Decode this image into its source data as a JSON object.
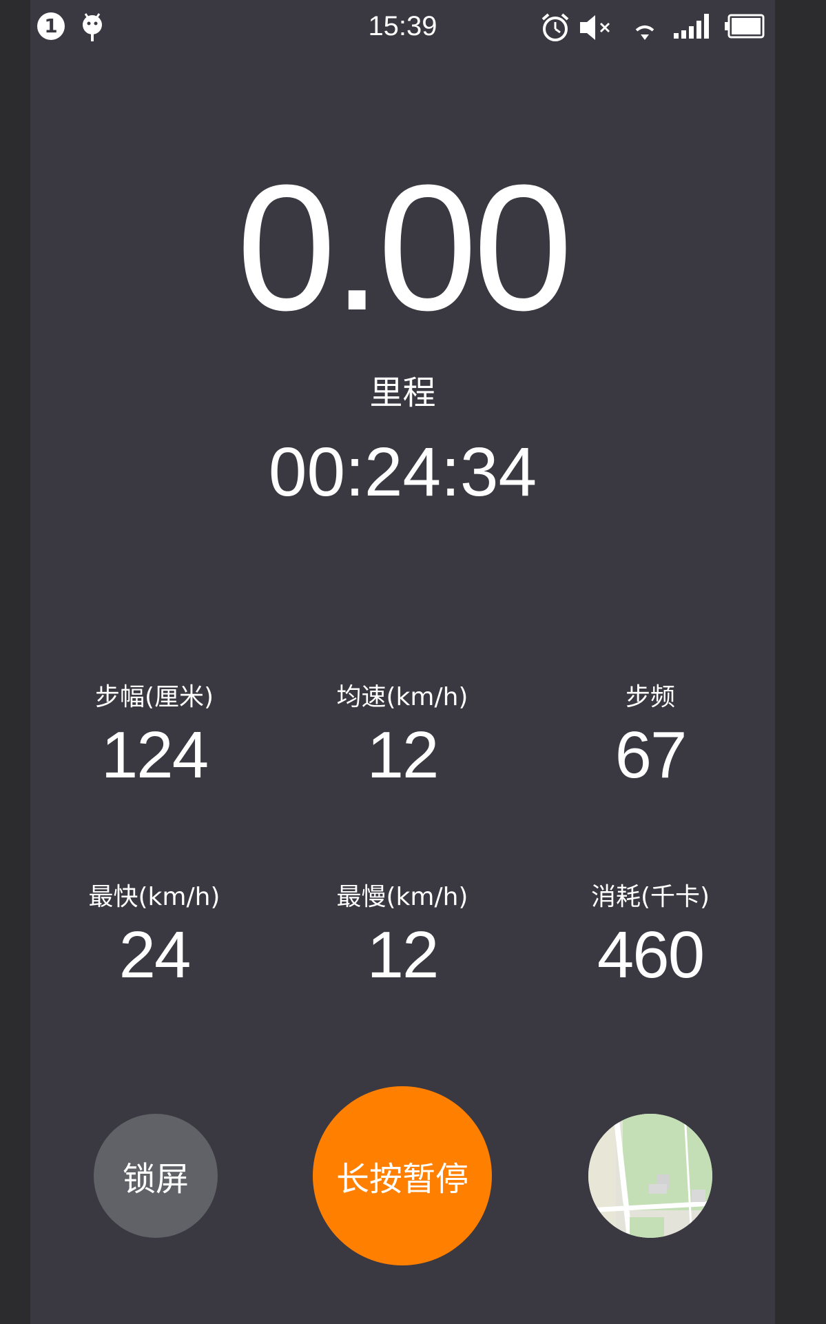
{
  "status_bar": {
    "notification_count": "1",
    "time": "15:39",
    "icons": [
      "notification-badge-icon",
      "android-icon",
      "alarm-icon",
      "mute-icon",
      "wifi-icon",
      "signal-icon",
      "battery-icon"
    ]
  },
  "distance": {
    "value": "0.00",
    "label": "里程"
  },
  "duration": "00:24:34",
  "stats": [
    {
      "label": "步幅(厘米)",
      "value": "124"
    },
    {
      "label": "均速(km/h)",
      "value": "12"
    },
    {
      "label": "步频",
      "value": "67"
    },
    {
      "label": "最快(km/h)",
      "value": "24"
    },
    {
      "label": "最慢(km/h)",
      "value": "12"
    },
    {
      "label": "消耗(千卡)",
      "value": "460"
    }
  ],
  "controls": {
    "lock_label": "锁屏",
    "pause_label": "长按暂停",
    "map_icon": "map-thumbnail"
  },
  "colors": {
    "background": "#3a3840",
    "text": "#ffffff",
    "duration_text": "#fefefe",
    "lock_button": "#616268",
    "pause_button": "#ff7f00",
    "map_green": "#c4dfb6"
  }
}
